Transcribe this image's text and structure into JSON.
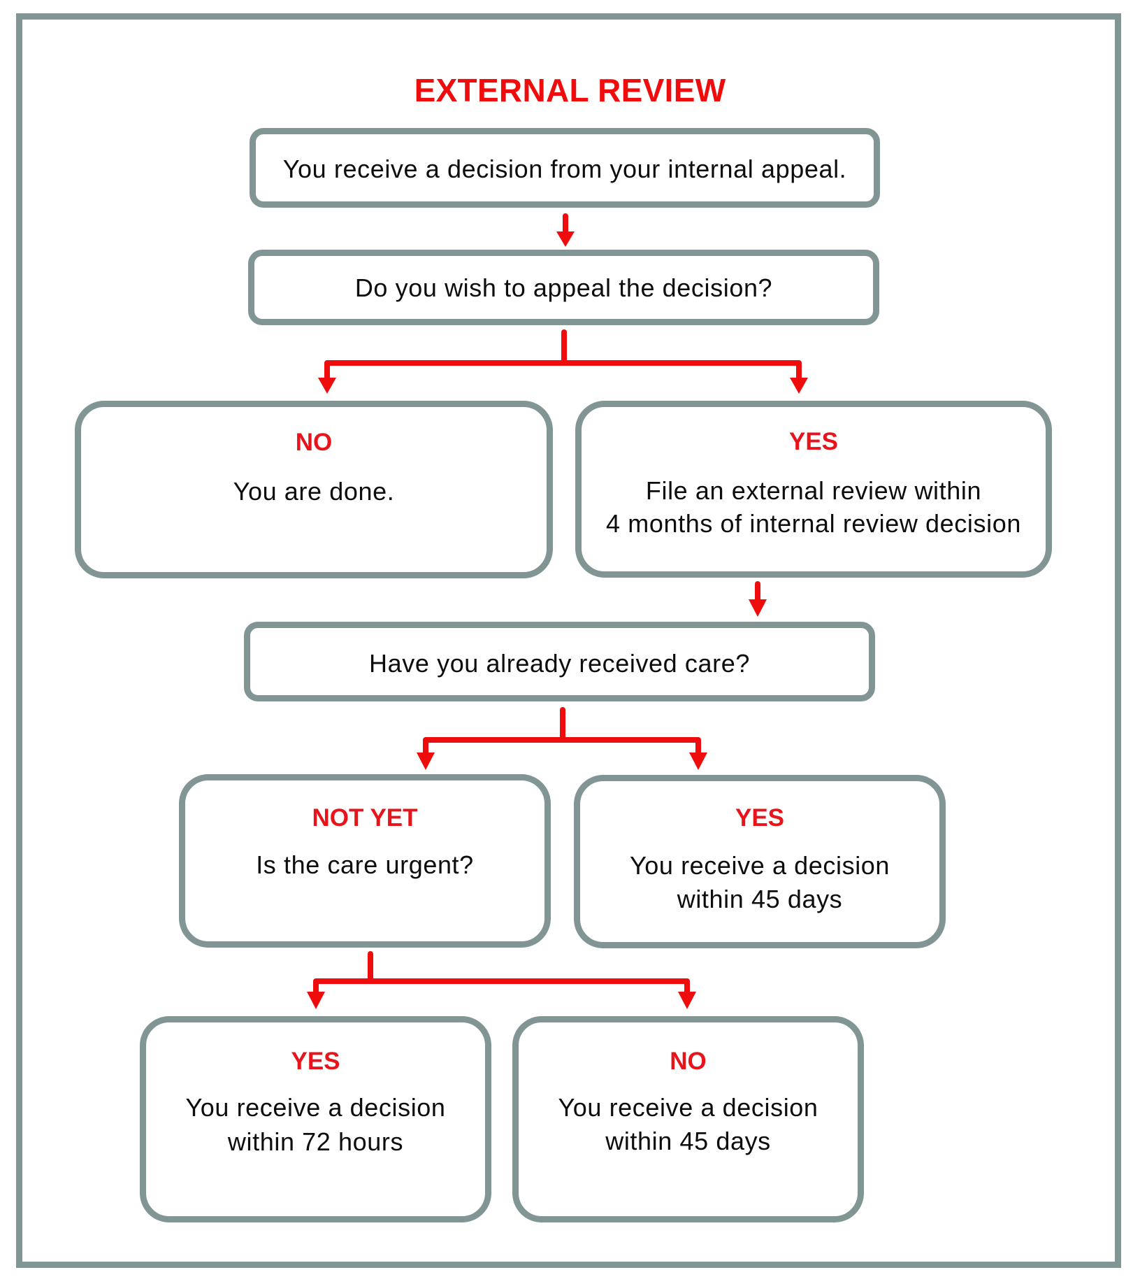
{
  "title": "EXTERNAL REVIEW",
  "colors": {
    "accent_red": "#ee0c0c",
    "box_border": "#819595",
    "text": "#0d0d0d"
  },
  "nodes": {
    "received_decision": {
      "text": "You receive a decision from your internal appeal."
    },
    "appeal_question": {
      "text": "Do you wish to appeal the decision?"
    },
    "appeal_no": {
      "label": "NO",
      "lines": [
        "You are done."
      ]
    },
    "appeal_yes": {
      "label": "YES",
      "lines": [
        "File an external review within",
        "4 months of internal review decision"
      ]
    },
    "care_question": {
      "text": "Have you already received care?"
    },
    "care_not_yet": {
      "label": "NOT YET",
      "lines": [
        "Is the care urgent?"
      ]
    },
    "care_yes": {
      "label": "YES",
      "lines": [
        "You receive a decision",
        "within 45 days"
      ]
    },
    "urgent_yes": {
      "label": "YES",
      "lines": [
        "You receive a decision",
        "within 72 hours"
      ]
    },
    "urgent_no": {
      "label": "NO",
      "lines": [
        "You receive a decision",
        "within 45 days"
      ]
    }
  },
  "edges": [
    {
      "from": "received_decision",
      "to": "appeal_question"
    },
    {
      "from": "appeal_question",
      "to": "appeal_no"
    },
    {
      "from": "appeal_question",
      "to": "appeal_yes"
    },
    {
      "from": "appeal_yes",
      "to": "care_question"
    },
    {
      "from": "care_question",
      "to": "care_not_yet"
    },
    {
      "from": "care_question",
      "to": "care_yes"
    },
    {
      "from": "care_not_yet",
      "to": "urgent_yes"
    },
    {
      "from": "care_not_yet",
      "to": "urgent_no"
    }
  ]
}
